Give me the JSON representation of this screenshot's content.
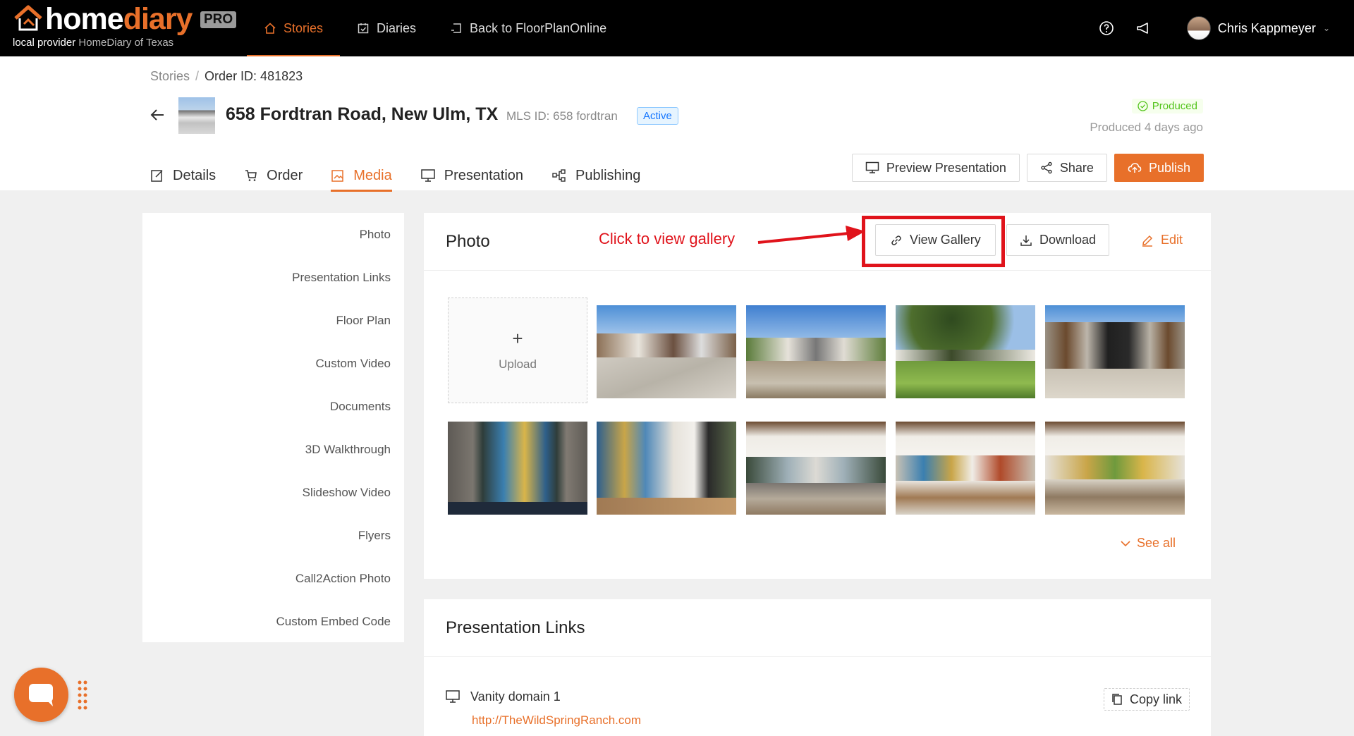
{
  "nav": {
    "logo_home": "home",
    "logo_diary": "diary",
    "logo_badge": "PRO",
    "provider_prefix": "local provider",
    "provider_name": "HomeDiary of Texas",
    "links": [
      {
        "label": "Stories",
        "icon": "home-icon"
      },
      {
        "label": "Diaries",
        "icon": "calendar-check-icon"
      },
      {
        "label": "Back to FloorPlanOnline",
        "icon": "back-square-icon"
      }
    ],
    "user_name": "Chris Kappmeyer",
    "accent": "#e8702a"
  },
  "header": {
    "breadcrumb": [
      "Stories",
      "Order ID: 481823"
    ],
    "title": "658 Fordtran Road, New Ulm, TX",
    "mls": "MLS ID: 658 fordtran",
    "status": "Active",
    "produced_tag": "Produced",
    "produced_time": "Produced 4 days ago",
    "tabs": [
      {
        "label": "Details",
        "icon": "edit-icon"
      },
      {
        "label": "Order",
        "icon": "cart-icon"
      },
      {
        "label": "Media",
        "icon": "media-icon"
      },
      {
        "label": "Presentation",
        "icon": "monitor-icon"
      },
      {
        "label": "Publishing",
        "icon": "share-nodes-icon"
      }
    ],
    "buttons": {
      "preview": "Preview Presentation",
      "share": "Share",
      "publish": "Publish"
    }
  },
  "sidebar": {
    "items": [
      "Photo",
      "Presentation Links",
      "Floor Plan",
      "Custom Video",
      "Documents",
      "3D Walkthrough",
      "Slideshow Video",
      "Flyers",
      "Call2Action Photo",
      "Custom Embed Code"
    ]
  },
  "photo_card": {
    "title": "Photo",
    "annotation": "Click to view gallery",
    "view_gallery": "View Gallery",
    "download": "Download",
    "edit": "Edit",
    "upload_label": "Upload",
    "upload_plus": "+",
    "see_all": "See all",
    "annotation_color": "#e0131b"
  },
  "links_card": {
    "title": "Presentation Links",
    "vanity_name": "Vanity domain 1",
    "vanity_url": "http://TheWildSpringRanch.com",
    "copy": "Copy link"
  }
}
